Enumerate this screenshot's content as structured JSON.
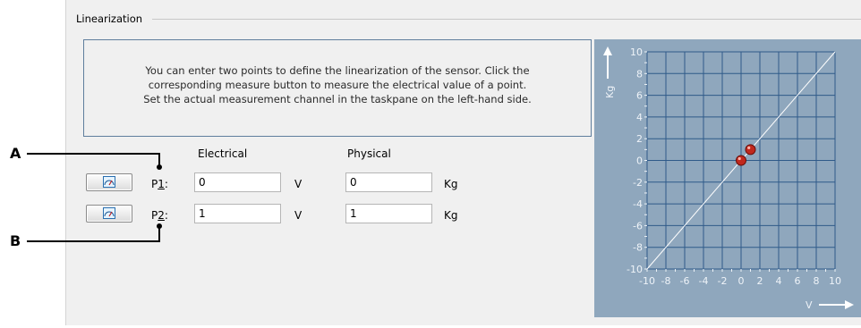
{
  "group": {
    "title": "Linearization"
  },
  "info": {
    "lines": [
      "You can enter two points to define the linearization of the sensor. Click the",
      "corresponding measure button to measure the electrical value of a point.",
      "Set the actual measurement channel in the taskpane on the left-hand side."
    ]
  },
  "columns": {
    "electrical": "Electrical",
    "physical": "Physical"
  },
  "points": [
    {
      "label_prefix": "P",
      "label_num": "1",
      "label_suffix": ":",
      "electrical": "0",
      "electrical_unit": "V",
      "physical": "0",
      "physical_unit": "Kg"
    },
    {
      "label_prefix": "P",
      "label_num": "2",
      "label_suffix": ":",
      "electrical": "1",
      "electrical_unit": "V",
      "physical": "1",
      "physical_unit": "Kg"
    }
  ],
  "callouts": {
    "a": "A",
    "b": "B"
  },
  "plot": {
    "x_ticks": [
      "-10",
      "-8",
      "-6",
      "-4",
      "-2",
      "0",
      "2",
      "4",
      "6",
      "8",
      "10"
    ],
    "y_ticks": [
      "10",
      "8",
      "6",
      "4",
      "2",
      "0",
      "-2",
      "-4",
      "-6",
      "-8",
      "-10"
    ],
    "x_axis_label": "V",
    "y_axis_label": "Kg",
    "range": [
      -10,
      10
    ],
    "markers": [
      {
        "x": 0,
        "y": 0
      },
      {
        "x": 1,
        "y": 1
      }
    ],
    "colors": {
      "background": "#8fa7bd",
      "grid": "#2f5a89",
      "line": "#ffffff",
      "marker": "#c0281d"
    }
  }
}
